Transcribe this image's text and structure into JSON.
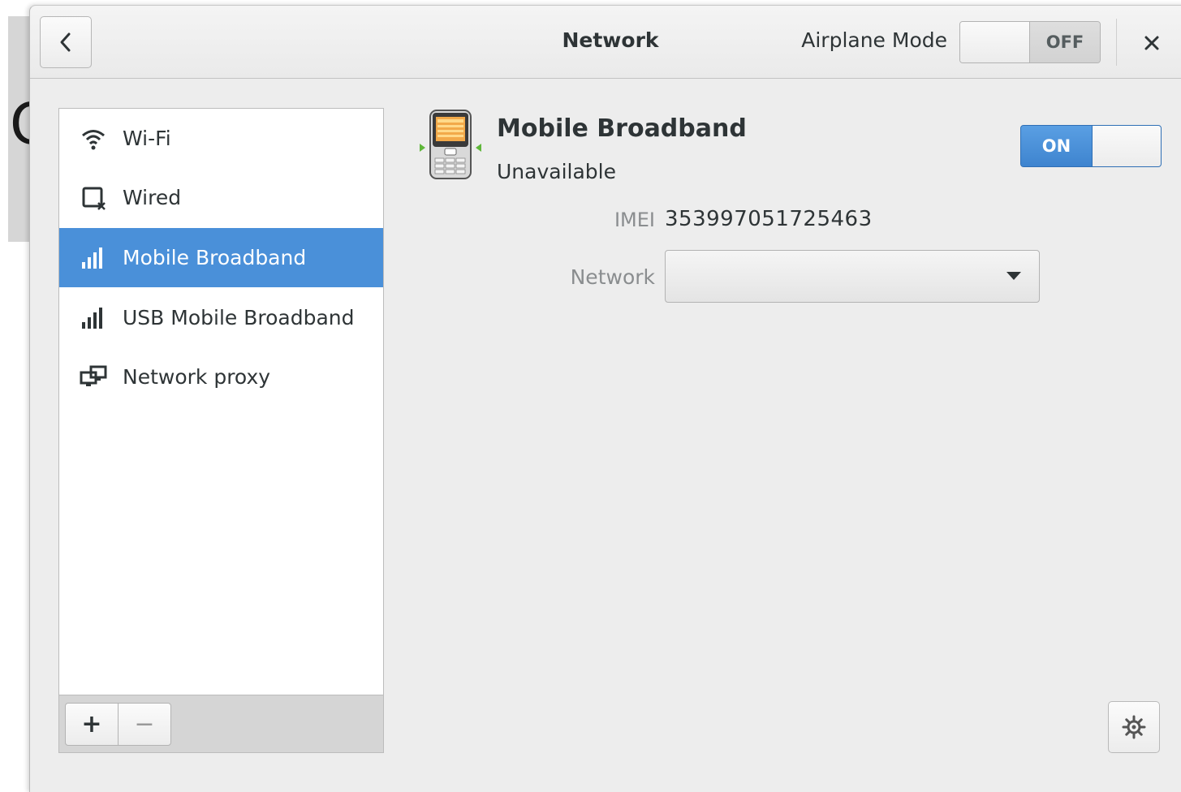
{
  "header": {
    "title": "Network",
    "airplane_mode_label": "Airplane Mode",
    "airplane_mode_state": "OFF"
  },
  "sidebar": {
    "items": [
      {
        "label": "Wi-Fi",
        "icon": "wifi-icon",
        "selected": false
      },
      {
        "label": "Wired",
        "icon": "wired-network-icon",
        "selected": false
      },
      {
        "label": "Mobile Broadband",
        "icon": "signal-bars-icon",
        "selected": true
      },
      {
        "label": "USB Mobile Broadband",
        "icon": "signal-bars-icon",
        "selected": false
      },
      {
        "label": "Network proxy",
        "icon": "network-proxy-icon",
        "selected": false
      }
    ],
    "add_label": "+",
    "remove_label": "−"
  },
  "device": {
    "name": "Mobile Broadband",
    "status": "Unavailable",
    "power_state": "ON",
    "imei_label": "IMEI",
    "imei_value": "353997051725463",
    "network_label": "Network",
    "network_value": ""
  },
  "colors": {
    "accent": "#4a90d9",
    "window_bg": "#ededed",
    "text": "#2e3436",
    "dim_text": "#8a8d8f"
  }
}
